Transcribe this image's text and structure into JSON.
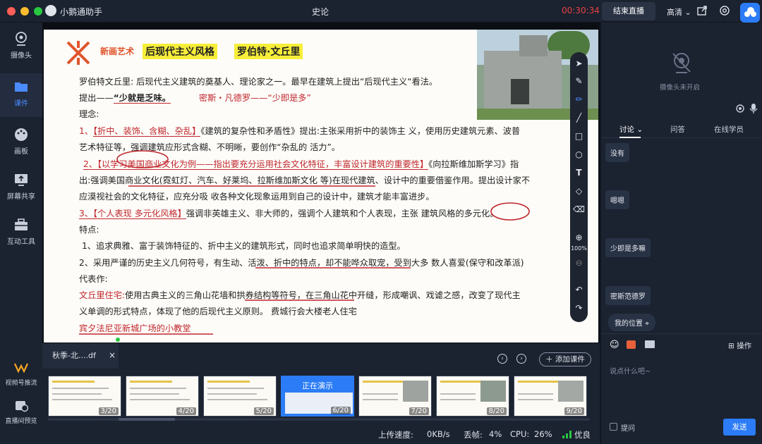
{
  "app": {
    "name": "小鹅通助手",
    "title": "史论",
    "timer": "00:30:34",
    "end_live_label": "结束直播",
    "quality_label": "高清"
  },
  "rail": {
    "items": [
      {
        "label": "摄像头"
      },
      {
        "label": "课件"
      },
      {
        "label": "画板"
      },
      {
        "label": "屏幕共享"
      },
      {
        "label": "互动工具"
      }
    ],
    "bottom": [
      {
        "label": "视频号推流"
      },
      {
        "label": "直播间预览"
      }
    ]
  },
  "slide": {
    "logo_text": "新画艺术",
    "title1": "后现代主义风格",
    "title2": "罗伯特·文丘里",
    "lines": [
      "罗伯特文丘里: 后现代主义建筑的奠基人、理论家之一。最早在建筑上提出“后现代主义“看法。",
      "理念:",
      "艺术特征等，强调建筑应形式含糊、不明晰，要创作“杂乱的 活力”。",
      "指",
      "出:强调美国商业文化(霓虹灯、汽车、好莱坞、拉斯维加斯文化 等)在现代建筑、设计中的重要借鉴作用。提出设计家不",
      "应漠视社会的文化特征，应充分吸 收各种文化现象运用到自己的设计中，建筑才能丰富进步。",
      "强调非英雄主义、非大师的，强调个人建筑和个人表现，主张 建筑风格的多元化。",
      "特点:",
      "1、追求典雅、富于装饰特征的、折中主义的建筑形式，同时也追求简单明快的造型。",
      "2、采用严谨的历史主义几何符号，有生动、活泼、折中的特点，却不能哗众取宠，受到大多 数人喜爱(保守和改革派)",
      "代表作:",
      "使用古典主义的三角山花墙和拱券结构等符号，在三角山花中开缝，形成嘲讽、戏谑之感，改变了现代主",
      "义单调的形式特点，体现了他的后现代主义原则。 费城行会大楼老人住宅",
      "宾夕法尼亚新城广场的小教堂"
    ],
    "proposal_prefix": "提出——",
    "proposal_quote": "“少就是乏味。",
    "proposal_contrast": "密斯・凡德罗——“少即是多”",
    "idea1_prefix": "1、",
    "idea1_red": "【折中、装饰、含糊、杂乱】",
    "idea1_rest": "《建筑的复杂性和矛盾性》提出:主张采用折中的装饰主 义，使用历史建筑元素、波普",
    "idea2_red": "2、【以学习美国商业文化为例——指出要充分运用社会文化特征，丰富设计建筑的重要性】",
    "idea2_rest": "《向拉斯维加斯学习》",
    "idea3_red": "3、【个人表现 多元化风格】",
    "works_red": "文丘里住宅:"
  },
  "drawtools": {
    "zoom": "100%"
  },
  "panel": {
    "camera_off": "摄像头未开启",
    "tabs": [
      "讨论",
      "问答",
      "在线学员"
    ],
    "messages": [
      "没有",
      "嗯嗯",
      "少即是多嘛",
      "密斯范德罗"
    ],
    "location": "我的位置",
    "operate": "操作",
    "input_placeholder": "说点什么吧~",
    "ask_label": "提问",
    "send_label": "发送"
  },
  "courseware": {
    "file_tab": "秋季-北....df",
    "add_label": "添加课件",
    "presenting_label": "正在演示",
    "pages": [
      "3/20",
      "4/20",
      "5/20",
      "6/20",
      "7/20",
      "8/20",
      "9/20"
    ]
  },
  "status": {
    "upload_label": "上传速度:",
    "upload_value": "0KB/s",
    "frame_label": "丢帧:",
    "frame_value": "4%",
    "cpu_label": "CPU:",
    "cpu_value": "26%",
    "quality_label": "优良"
  },
  "colors": {
    "accent": "#2b7cf6",
    "end_button": "#2a3344",
    "timer": "#e8423f",
    "slide_red": "#c0262d",
    "highlight": "#f7ee3a"
  }
}
